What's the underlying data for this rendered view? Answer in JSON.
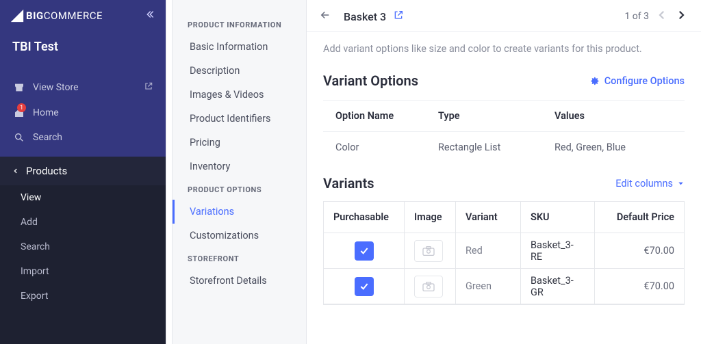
{
  "brand": {
    "name_a": "BIG",
    "name_b": "COMMERCE"
  },
  "store": {
    "name": "TBI Test"
  },
  "nav": {
    "view_store": "View Store",
    "home": "Home",
    "home_badge": "1",
    "search": "Search",
    "section": "Products",
    "subitems": [
      {
        "label": "View",
        "active": true
      },
      {
        "label": "Add"
      },
      {
        "label": "Search"
      },
      {
        "label": "Import"
      },
      {
        "label": "Export"
      }
    ]
  },
  "sidenav": {
    "groups": [
      {
        "heading": "PRODUCT INFORMATION",
        "items": [
          {
            "label": "Basic Information"
          },
          {
            "label": "Description"
          },
          {
            "label": "Images & Videos"
          },
          {
            "label": "Product Identifiers"
          },
          {
            "label": "Pricing"
          },
          {
            "label": "Inventory"
          }
        ]
      },
      {
        "heading": "PRODUCT OPTIONS",
        "items": [
          {
            "label": "Variations",
            "active": true
          },
          {
            "label": "Customizations"
          }
        ]
      },
      {
        "heading": "STOREFRONT",
        "items": [
          {
            "label": "Storefront Details"
          }
        ]
      }
    ]
  },
  "topbar": {
    "title": "Basket 3",
    "pager": "1 of 3"
  },
  "hint": "Add variant options like size and color to create variants for this product.",
  "opts": {
    "title": "Variant Options",
    "config": "Configure Options",
    "cols": {
      "name": "Option Name",
      "type": "Type",
      "values": "Values"
    },
    "rows": [
      {
        "name": "Color",
        "type": "Rectangle List",
        "values": "Red, Green, Blue"
      }
    ]
  },
  "vars": {
    "title": "Variants",
    "edit": "Edit columns",
    "cols": {
      "purch": "Purchasable",
      "image": "Image",
      "variant": "Variant",
      "sku": "SKU",
      "price": "Default Price"
    },
    "rows": [
      {
        "purch": true,
        "variant": "Red",
        "sku": "Basket_3-RE",
        "price": "€70.00"
      },
      {
        "purch": true,
        "variant": "Green",
        "sku": "Basket_3-GR",
        "price": "€70.00"
      }
    ]
  }
}
